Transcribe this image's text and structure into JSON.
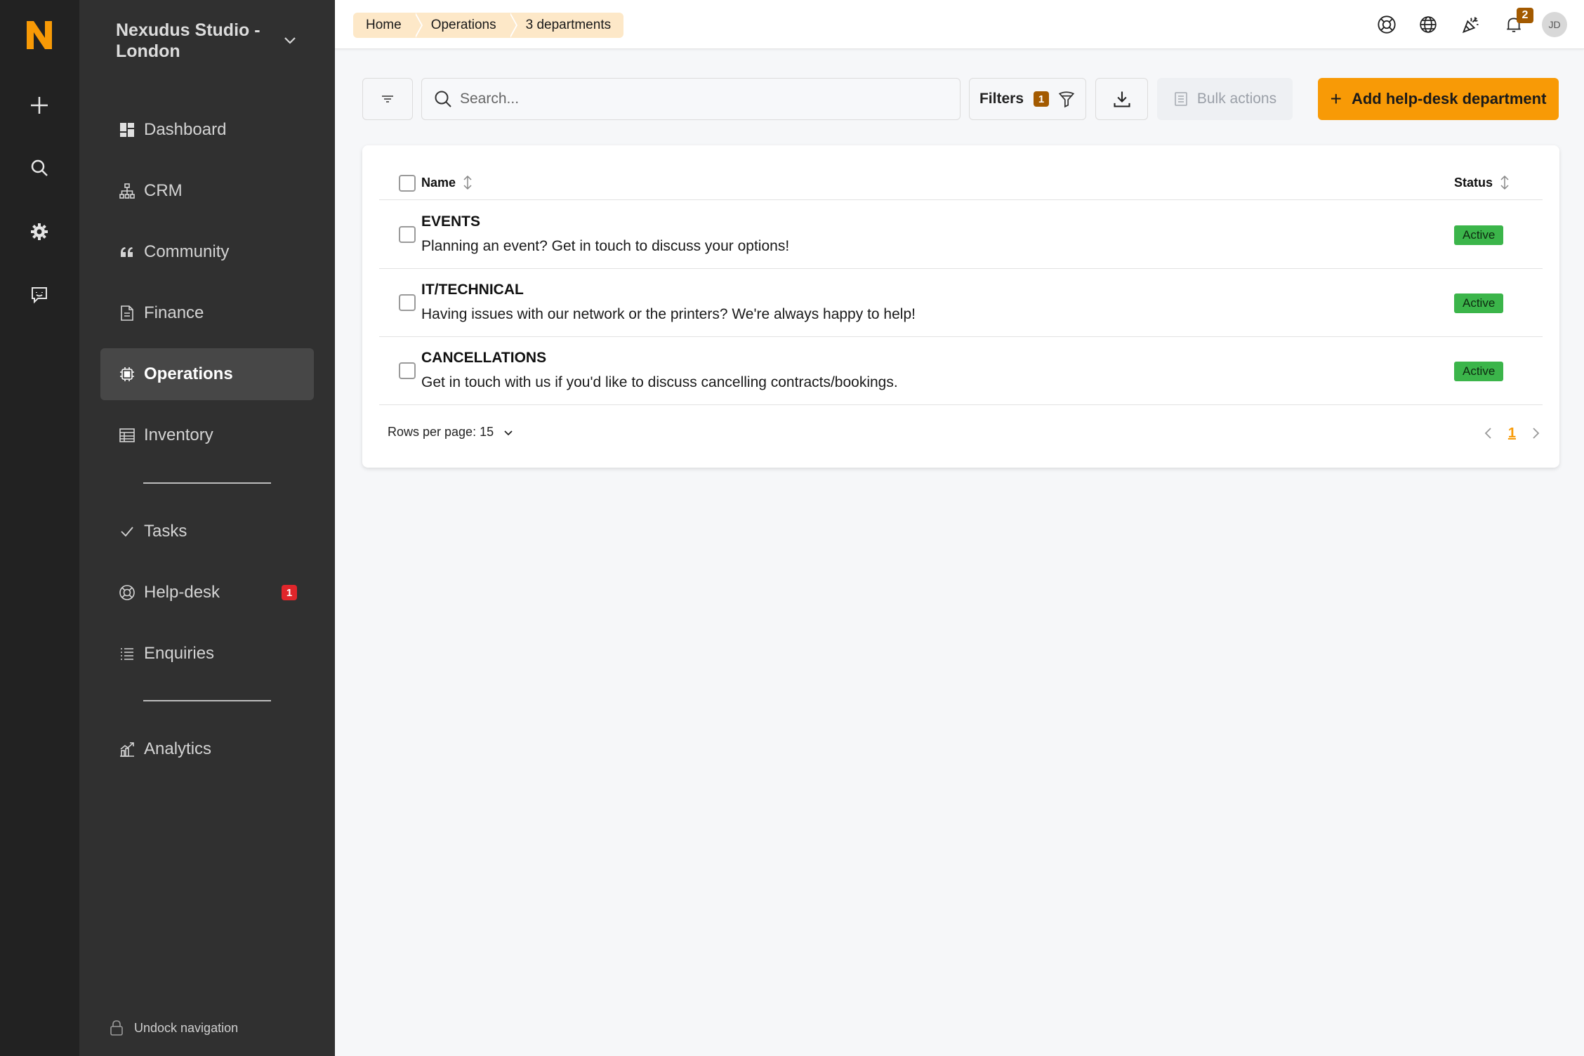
{
  "rail": {
    "logo_letter": "N",
    "items": [
      {
        "icon": "plus-icon"
      },
      {
        "icon": "search-icon"
      },
      {
        "icon": "gear-icon"
      },
      {
        "icon": "chat-feedback-icon"
      }
    ]
  },
  "sidebar": {
    "workspace_name": "Nexudus Studio - London",
    "items": [
      {
        "label": "Dashboard",
        "icon": "dashboard-icon"
      },
      {
        "label": "CRM",
        "icon": "crm-icon"
      },
      {
        "label": "Community",
        "icon": "quote-icon"
      },
      {
        "label": "Finance",
        "icon": "document-icon"
      },
      {
        "label": "Operations",
        "icon": "chip-icon"
      },
      {
        "label": "Inventory",
        "icon": "table-icon"
      },
      {
        "label": "Tasks",
        "icon": "check-icon"
      },
      {
        "label": "Help-desk",
        "icon": "lifebuoy-icon",
        "badge": "1"
      },
      {
        "label": "Enquiries",
        "icon": "list-icon"
      },
      {
        "label": "Analytics",
        "icon": "chart-icon"
      }
    ],
    "undock_label": "Undock navigation"
  },
  "topbar": {
    "breadcrumbs": [
      "Home",
      "Operations",
      "3 departments"
    ],
    "notifications_count": "2",
    "avatar_initials": "JD"
  },
  "toolbar": {
    "search_placeholder": "Search...",
    "filters_label": "Filters",
    "filters_count": "1",
    "bulk_label": "Bulk actions",
    "add_label": "Add help-desk department"
  },
  "table": {
    "columns": [
      "Name",
      "Status"
    ],
    "rows": [
      {
        "title": "EVENTS",
        "description": "Planning an event? Get in touch to discuss your options!",
        "status": "Active"
      },
      {
        "title": "IT/TECHNICAL",
        "description": "Having issues with our network or the printers? We're always happy to help!",
        "status": "Active"
      },
      {
        "title": "CANCELLATIONS",
        "description": "Get in touch with us if you'd like to discuss cancelling contracts/bookings.",
        "status": "Active"
      }
    ],
    "rows_per_page_label": "Rows per page: 15",
    "current_page": "1"
  },
  "colors": {
    "accent": "#f89a06",
    "badge_brown": "#a35a00",
    "status_green": "#3bb54a",
    "rail_bg": "#222222",
    "sidebar_bg": "#303030",
    "breadcrumb_bg": "#fde8c8"
  }
}
